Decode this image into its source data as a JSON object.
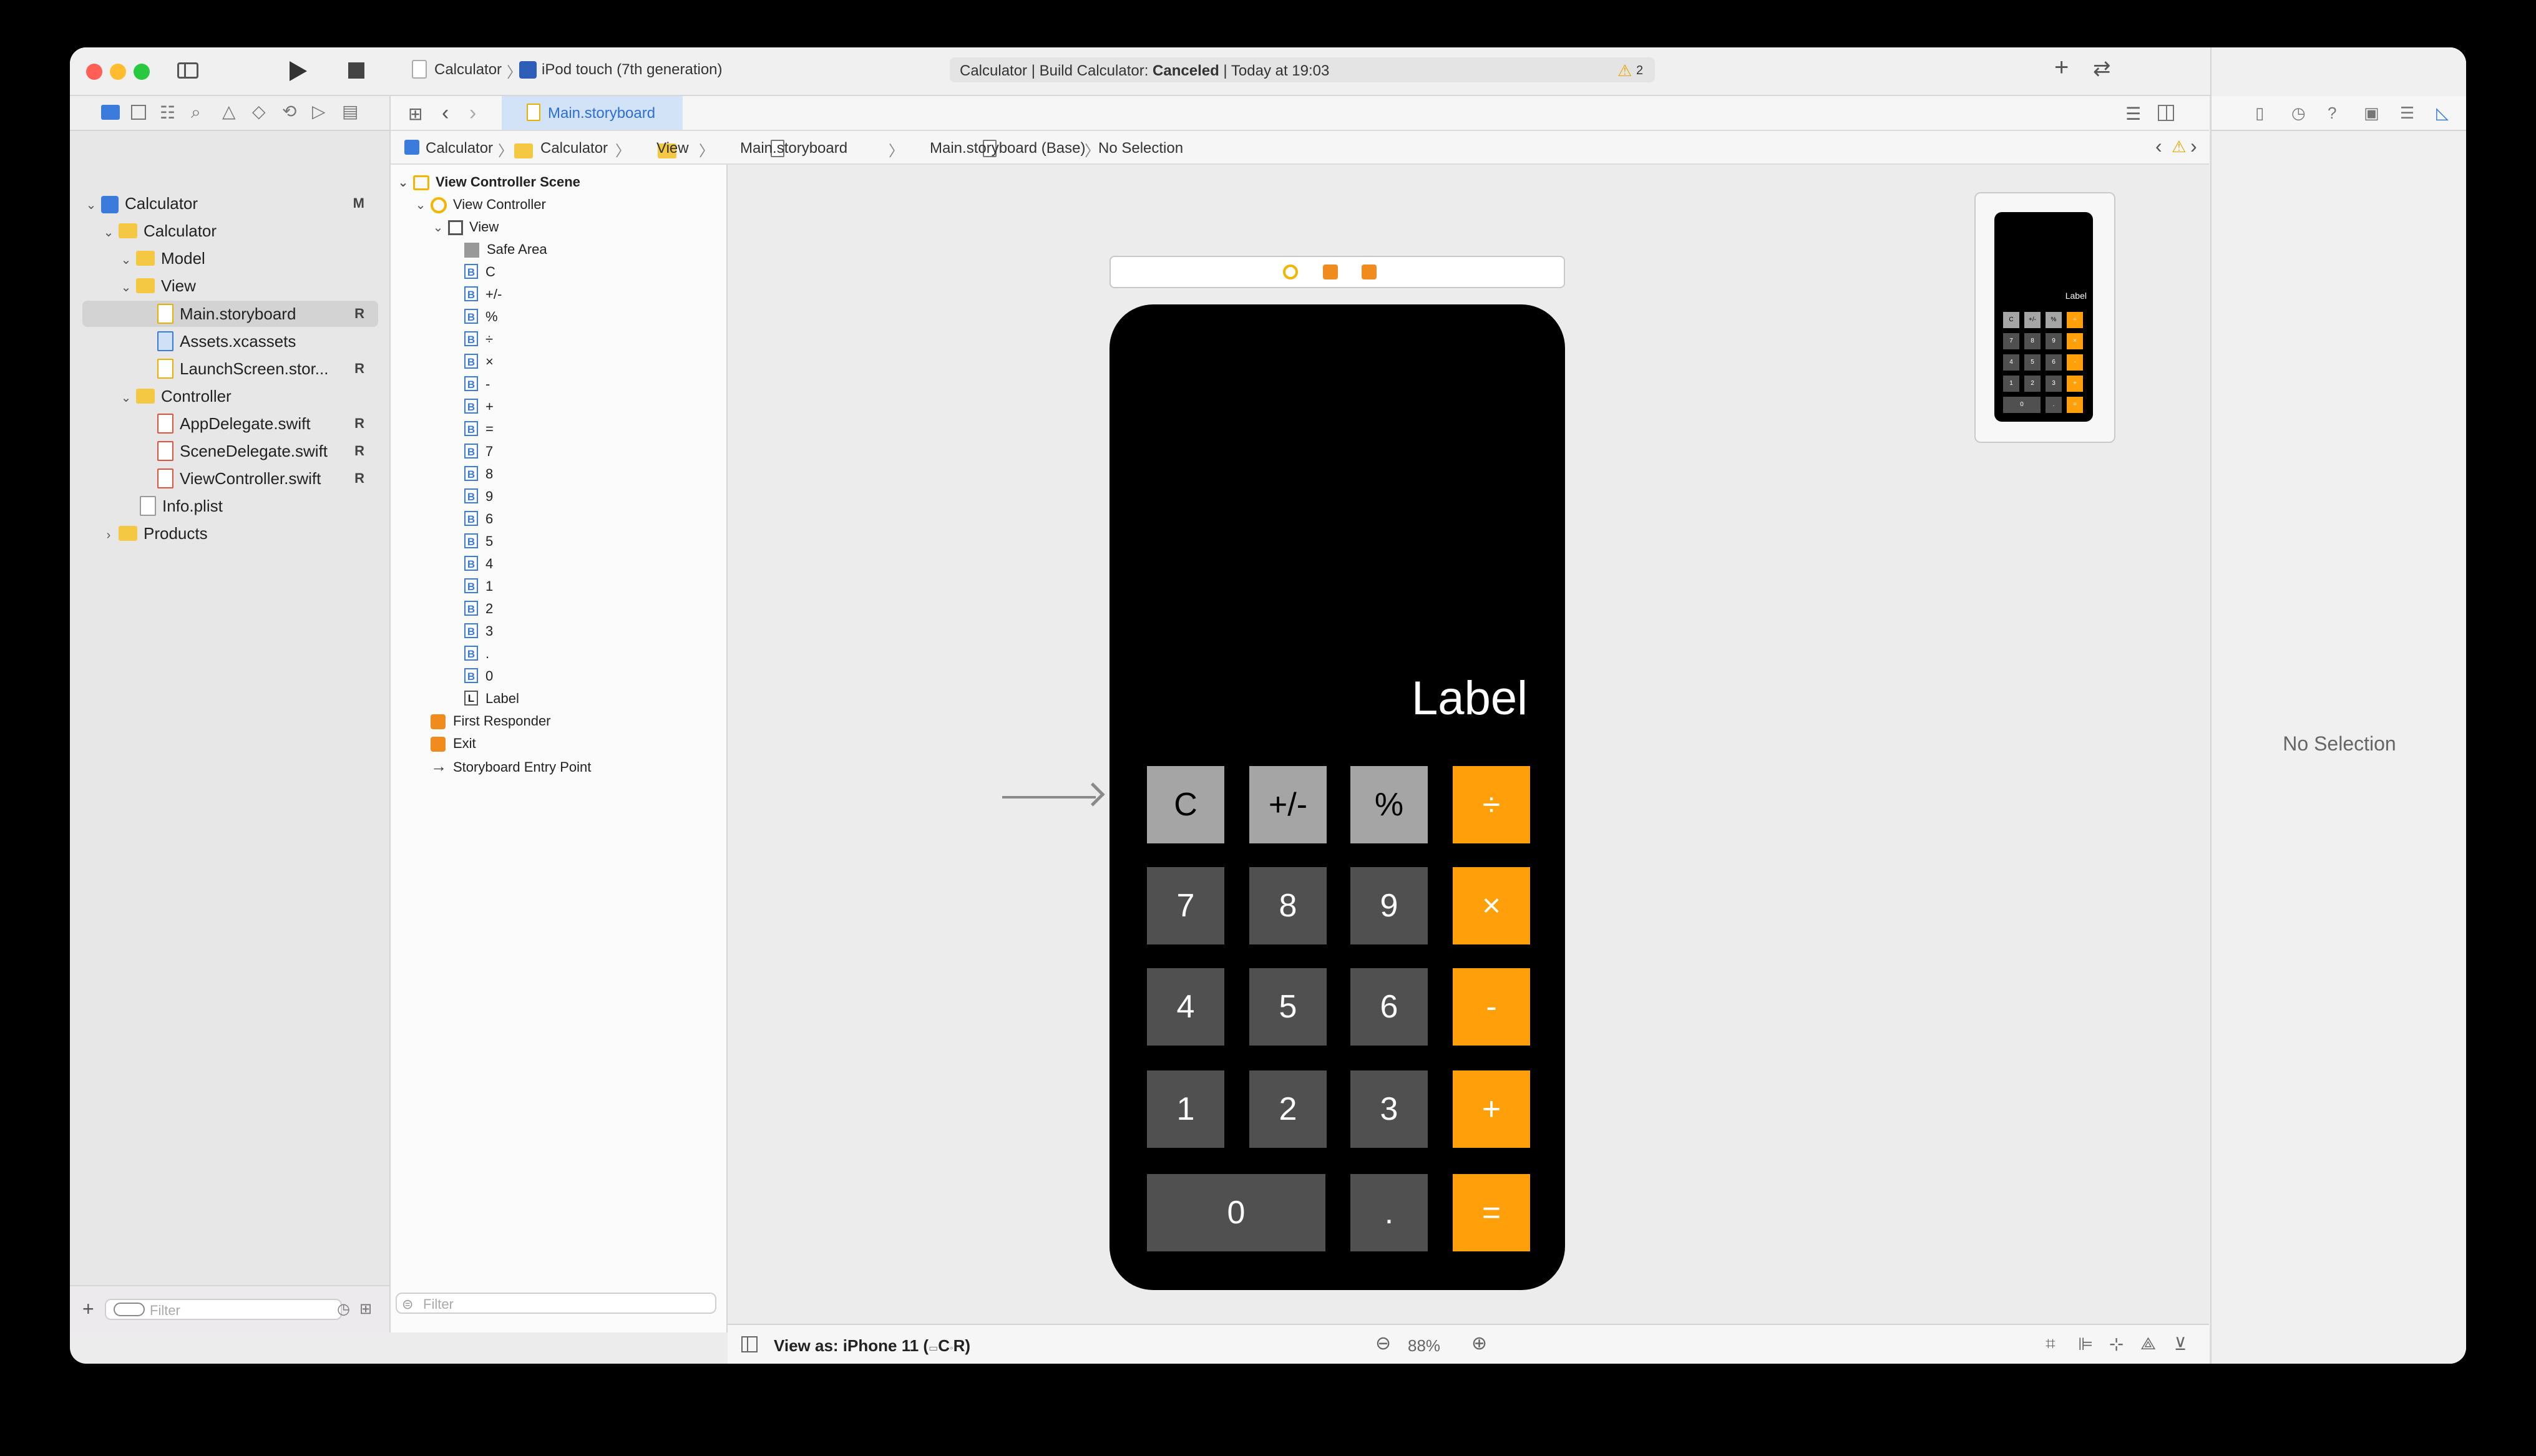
{
  "titlebar": {
    "scheme": "Calculator",
    "device": "iPod touch (7th generation)",
    "status_prefix": "Calculator | Build Calculator: ",
    "status_state": "Canceled",
    "status_suffix": " | Today at 19:03",
    "warnings": "2"
  },
  "editor": {
    "tab": "Main.storyboard",
    "breadcrumb": [
      "Calculator",
      "Calculator",
      "View",
      "Main.storyboard",
      "Main.storyboard (Base)",
      "No Selection"
    ]
  },
  "navigator": {
    "items": [
      {
        "label": "Calculator",
        "badge": "M"
      },
      {
        "label": "Calculator",
        "badge": ""
      },
      {
        "label": "Model",
        "badge": ""
      },
      {
        "label": "View",
        "badge": ""
      },
      {
        "label": "Main.storyboard",
        "badge": "R"
      },
      {
        "label": "Assets.xcassets",
        "badge": ""
      },
      {
        "label": "LaunchScreen.stor...",
        "badge": "R"
      },
      {
        "label": "Controller",
        "badge": ""
      },
      {
        "label": "AppDelegate.swift",
        "badge": "R"
      },
      {
        "label": "SceneDelegate.swift",
        "badge": "R"
      },
      {
        "label": "ViewController.swift",
        "badge": "R"
      },
      {
        "label": "Info.plist",
        "badge": ""
      },
      {
        "label": "Products",
        "badge": ""
      }
    ],
    "filter_placeholder": "Filter"
  },
  "outline": {
    "items": [
      "View Controller Scene",
      "View Controller",
      "View",
      "Safe Area",
      "C",
      "+/-",
      "%",
      "÷",
      "×",
      "-",
      "+",
      "=",
      "7",
      "8",
      "9",
      "6",
      "5",
      "4",
      "1",
      "2",
      "3",
      ".",
      "0",
      "Label",
      "First Responder",
      "Exit",
      "Storyboard Entry Point"
    ],
    "filter_placeholder": "Filter"
  },
  "canvas": {
    "label_text": "Label",
    "keys": [
      "C",
      "+/-",
      "%",
      "÷",
      "7",
      "8",
      "9",
      "×",
      "4",
      "5",
      "6",
      "-",
      "1",
      "2",
      "3",
      "+",
      "0",
      ".",
      "="
    ],
    "view_as": "View as: iPhone 11 (",
    "view_as_mid": "C",
    "view_as_end": "R)",
    "zoom": "88%"
  },
  "minimap": {
    "label_text": "Label",
    "keys": [
      "C",
      "+/-",
      "%",
      "÷",
      "7",
      "8",
      "9",
      "×",
      "4",
      "5",
      "6",
      "-",
      "1",
      "2",
      "3",
      "+",
      "0",
      ".",
      "="
    ]
  },
  "inspector": {
    "empty": "No Selection"
  },
  "colors": {
    "orange": "#ff9f0a",
    "light_key": "#a5a5a5",
    "dark_key": "#505050",
    "accent": "#3a7bdc"
  }
}
